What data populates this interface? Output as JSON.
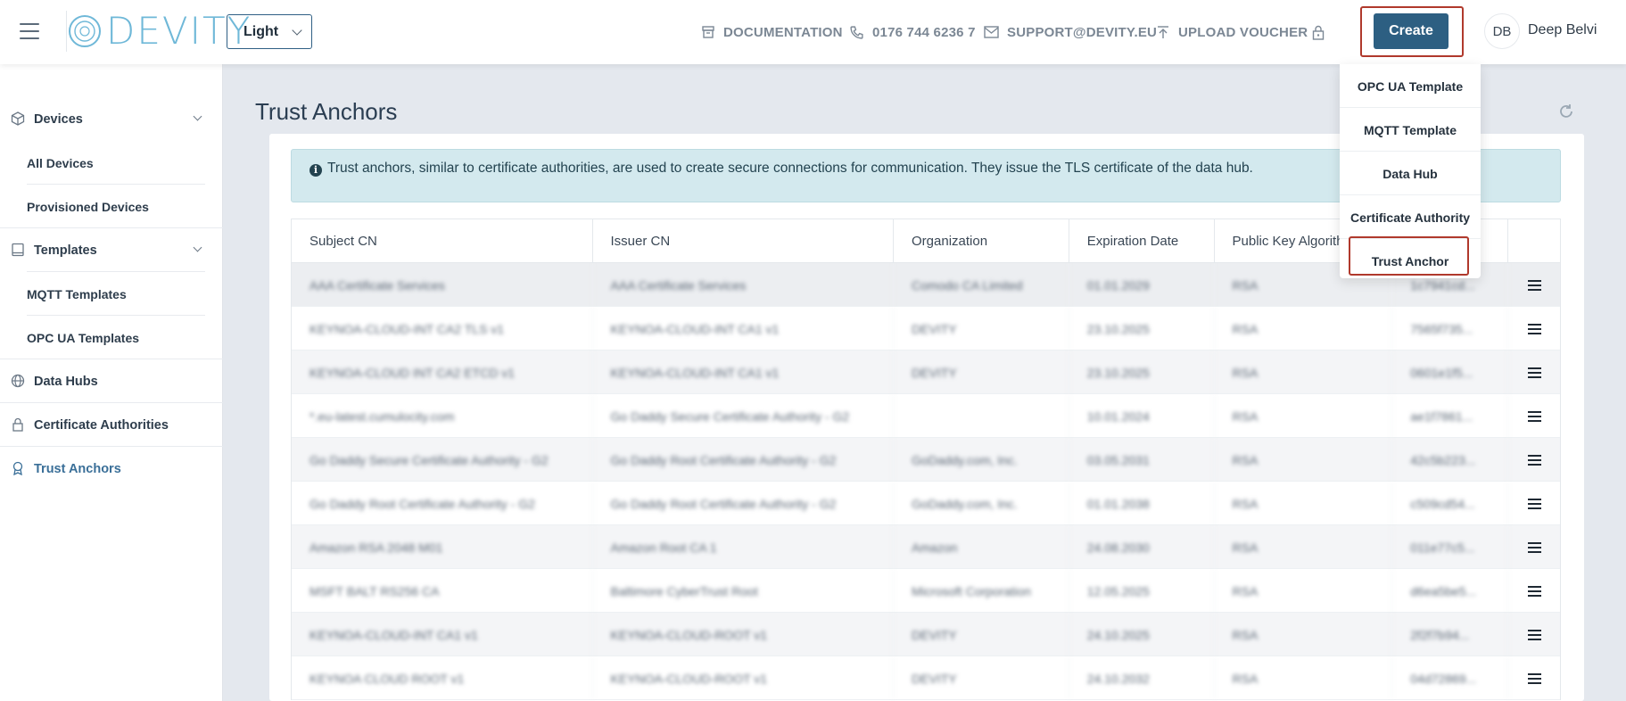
{
  "header": {
    "logo_text": "DEVITY",
    "theme": "Light",
    "nav": {
      "documentation": "DOCUMENTATION",
      "phone": "0176 744 6236 7",
      "support": "SUPPORT@DEVITY.EU",
      "upload": "UPLOAD VOUCHER"
    },
    "create_label": "Create",
    "user_initials": "DB",
    "user_name": "Deep Belvi"
  },
  "create_menu": {
    "items": [
      "OPC UA Template",
      "MQTT Template",
      "Data Hub",
      "Certificate Authority",
      "Trust Anchor"
    ],
    "highlighted": "Trust Anchor"
  },
  "sidebar": {
    "devices": "Devices",
    "all_devices": "All Devices",
    "provisioned_devices": "Provisioned Devices",
    "templates": "Templates",
    "mqtt_templates": "MQTT Templates",
    "opcua_templates": "OPC UA Templates",
    "data_hubs": "Data Hubs",
    "certificate_authorities": "Certificate Authorities",
    "trust_anchors": "Trust Anchors",
    "active": "Trust Anchors"
  },
  "page": {
    "title": "Trust Anchors",
    "info": "Trust anchors, similar to certificate authorities, are used to create secure connections for communication. They issue the TLS certificate of the data hub."
  },
  "table": {
    "columns": [
      "Subject CN",
      "Issuer CN",
      "Organization",
      "Expiration Date",
      "Public Key Algorithm",
      ""
    ],
    "rows": [
      [
        "AAA Certificate Services",
        "AAA Certificate Services",
        "Comodo CA Limited",
        "01.01.2029",
        "RSA",
        "1c7941cd..."
      ],
      [
        "KEYNOA-CLOUD-INT CA2 TLS v1",
        "KEYNOA-CLOUD-INT CA1 v1",
        "DEVITY",
        "23.10.2025",
        "RSA",
        "7565f735..."
      ],
      [
        "KEYNOA-CLOUD INT CA2 ETCD v1",
        "KEYNOA-CLOUD-INT CA1 v1",
        "DEVITY",
        "23.10.2025",
        "RSA",
        "0601e1f5..."
      ],
      [
        "*.eu-latest.cumulocity.com",
        "Go Daddy Secure Certificate Authority - G2",
        "",
        "10.01.2024",
        "RSA",
        "ae1f7861..."
      ],
      [
        "Go Daddy Secure Certificate Authority - G2",
        "Go Daddy Root Certificate Authority - G2",
        "GoDaddy.com, Inc.",
        "03.05.2031",
        "RSA",
        "42c5b223..."
      ],
      [
        "Go Daddy Root Certificate Authority - G2",
        "Go Daddy Root Certificate Authority - G2",
        "GoDaddy.com, Inc.",
        "01.01.2038",
        "RSA",
        "c509cd54..."
      ],
      [
        "Amazon RSA 2048 M01",
        "Amazon Root CA 1",
        "Amazon",
        "24.08.2030",
        "RSA",
        "011e77c5..."
      ],
      [
        "MSFT BALT RS256 CA",
        "Baltimore CyberTrust Root",
        "Microsoft Corporation",
        "12.05.2025",
        "RSA",
        "d6ea5be5..."
      ],
      [
        "KEYNOA-CLOUD-INT CA1 v1",
        "KEYNOA-CLOUD-ROOT v1",
        "DEVITY",
        "24.10.2025",
        "RSA",
        "2f2f7b94..."
      ],
      [
        "KEYNOA CLOUD ROOT v1",
        "KEYNOA-CLOUD-ROOT v1",
        "DEVITY",
        "24.10.2032",
        "RSA",
        "04d72869..."
      ]
    ]
  },
  "colors": {
    "primary": "#2d5f82",
    "highlight_border": "#b0392c",
    "info_bg": "#d3e9ee",
    "logo": "#6fb8d8"
  }
}
